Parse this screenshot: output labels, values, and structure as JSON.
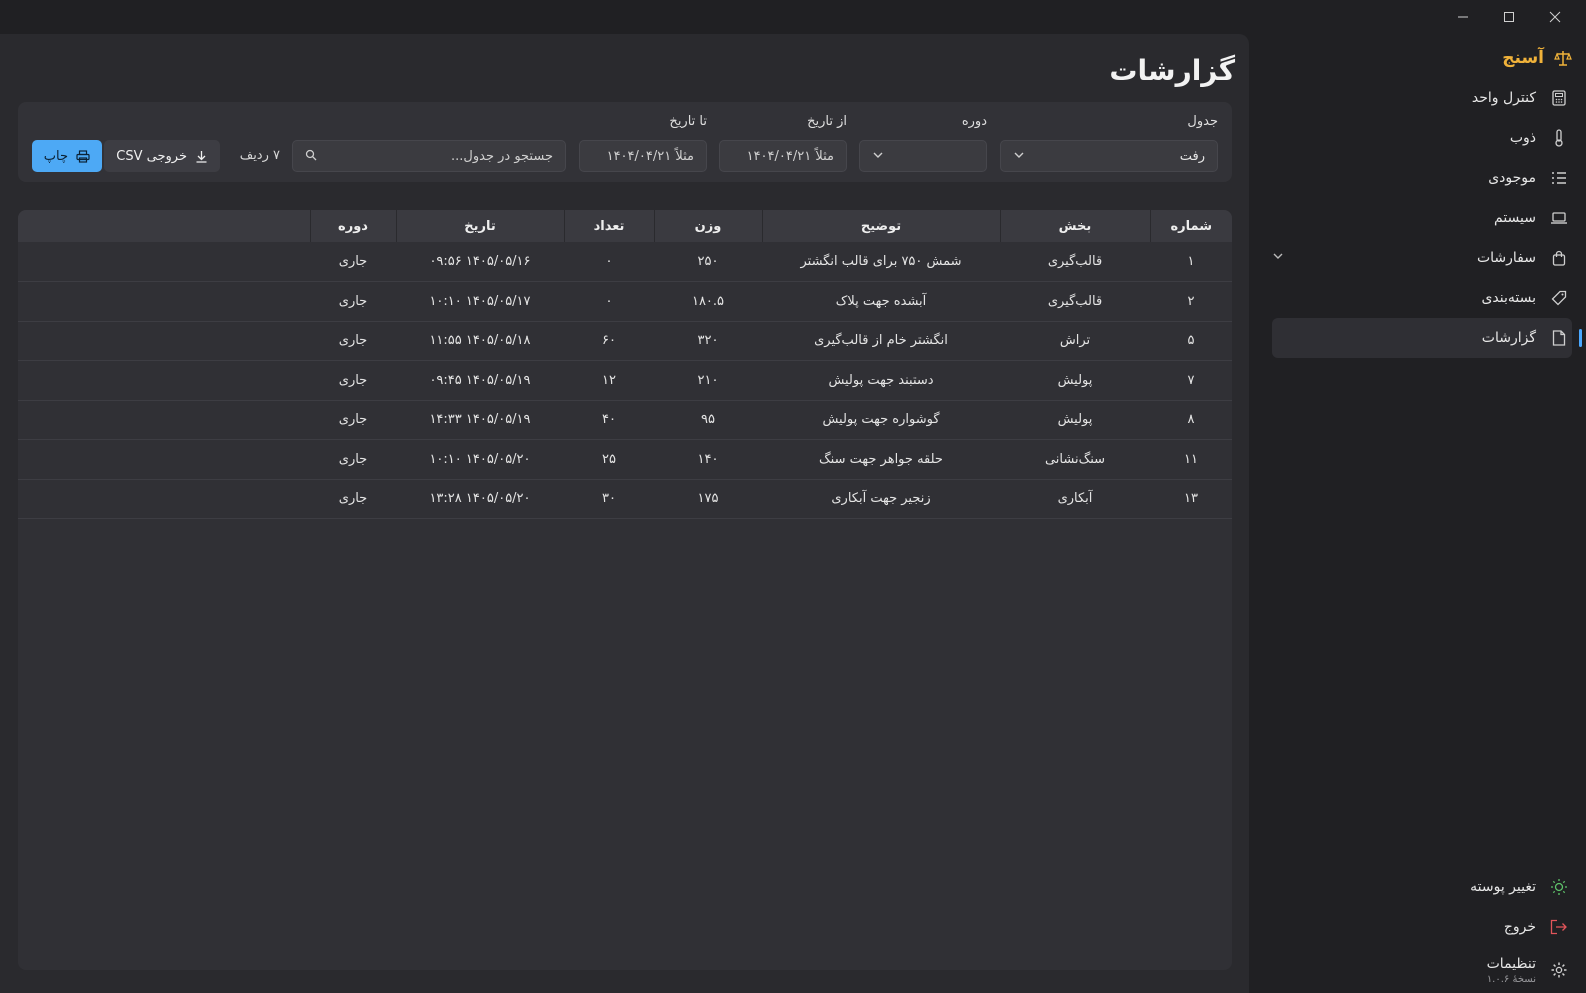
{
  "brand": {
    "name": "آسنج"
  },
  "sidebar": {
    "items": [
      {
        "label": "کنترل واحد",
        "icon": "calculator-icon"
      },
      {
        "label": "ذوب",
        "icon": "thermometer-icon"
      },
      {
        "label": "موجودی",
        "icon": "list-icon"
      },
      {
        "label": "سیستم",
        "icon": "laptop-icon"
      },
      {
        "label": "سفارشات",
        "icon": "shopping-bag-icon"
      },
      {
        "label": "بسته‌بندی",
        "icon": "tag-icon"
      },
      {
        "label": "گزارشات",
        "icon": "document-icon",
        "active": true
      }
    ],
    "bottom": [
      {
        "label": "تغییر پوسته",
        "icon": "sun-icon"
      },
      {
        "label": "خروج",
        "icon": "logout-icon"
      },
      {
        "label": "تنظیمات",
        "sub": "نسخهٔ ۱.۰.۶",
        "icon": "gear-icon"
      }
    ]
  },
  "page": {
    "title": "گزارشات"
  },
  "filters": {
    "table_label": "جدول",
    "table_value": "رفت",
    "period_label": "دوره",
    "period_value": "",
    "from_label": "از تاریخ",
    "from_placeholder": "مثلاً ۱۴۰۴/۰۴/۲۱",
    "to_label": "تا تاریخ",
    "to_placeholder": "مثلاً ۱۴۰۴/۰۴/۲۱",
    "search_placeholder": "جستجو در جدول...",
    "rows_count": "۷ ردیف",
    "csv_label": "خروجی CSV",
    "print_label": "چاپ"
  },
  "table": {
    "columns": [
      "شماره",
      "بخش",
      "توضیح",
      "وزن",
      "تعداد",
      "تاریخ",
      "دوره",
      ""
    ],
    "rows": [
      [
        "۱",
        "قالب‌گیری",
        "شمش ۷۵۰ برای قالب انگشتر",
        "۲۵۰",
        "۰",
        "۱۴۰۵/۰۵/۱۶ ۰۹:۵۶",
        "جاری"
      ],
      [
        "۲",
        "قالب‌گیری",
        "آبشده جهت پلاک",
        "۱۸۰.۵",
        "۰",
        "۱۴۰۵/۰۵/۱۷ ۱۰:۱۰",
        "جاری"
      ],
      [
        "۵",
        "تراش",
        "انگشتر خام از قالب‌گیری",
        "۳۲۰",
        "۶۰",
        "۱۴۰۵/۰۵/۱۸ ۱۱:۵۵",
        "جاری"
      ],
      [
        "۷",
        "پولیش",
        "دستبند جهت پولیش",
        "۲۱۰",
        "۱۲",
        "۱۴۰۵/۰۵/۱۹ ۰۹:۴۵",
        "جاری"
      ],
      [
        "۸",
        "پولیش",
        "گوشواره جهت پولیش",
        "۹۵",
        "۴۰",
        "۱۴۰۵/۰۵/۱۹ ۱۴:۳۳",
        "جاری"
      ],
      [
        "۱۱",
        "سنگ‌نشانی",
        "حلقه جواهر جهت سنگ",
        "۱۴۰",
        "۲۵",
        "۱۴۰۵/۰۵/۲۰ ۱۰:۱۰",
        "جاری"
      ],
      [
        "۱۳",
        "آبکاری",
        "زنجیر جهت آبکاری",
        "۱۷۵",
        "۳۰",
        "۱۴۰۵/۰۵/۲۰ ۱۳:۲۸",
        "جاری"
      ]
    ]
  },
  "colors": {
    "accent": "#4da9f5",
    "brand": "#f0b23a",
    "background": "#202023",
    "panel": "#2a2a2e"
  }
}
